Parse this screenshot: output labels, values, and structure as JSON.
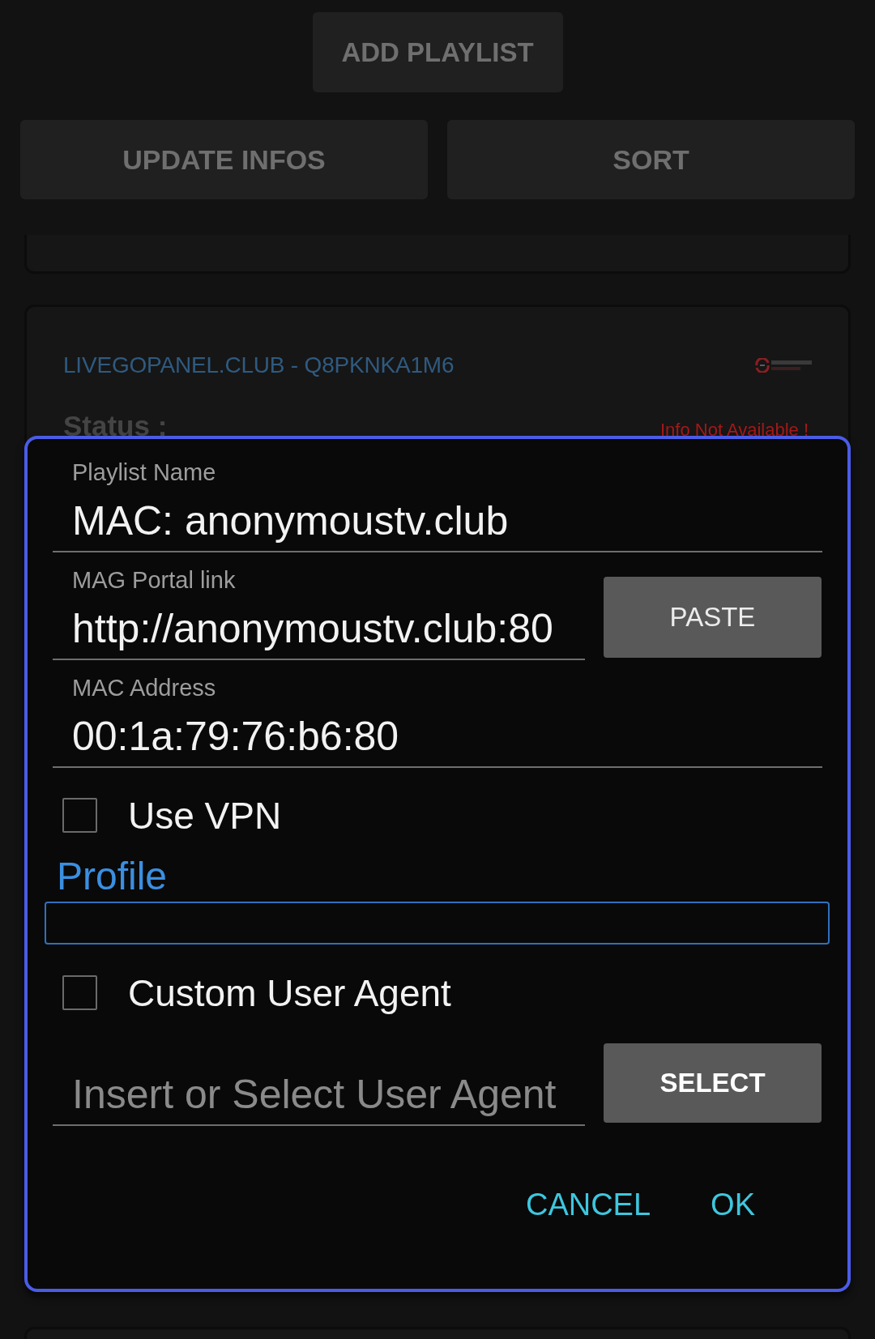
{
  "toolbar": {
    "add_button": "ADD PLAYLIST",
    "buttons": [
      "UPDATE INFOS",
      "SORT"
    ]
  },
  "playlists": [
    {
      "title": "LIVEGOPANEL.CLUB - Q8PKNKA1M6",
      "logo": {
        "kind": "swirl"
      },
      "rows": [
        {
          "label": "Status :",
          "value": "Info Not Available !",
          "kind": "error"
        }
      ]
    }
  ],
  "dialog": {
    "fields": [
      {
        "label": "Playlist Name",
        "value": "MAC: anonymoustv.club"
      },
      {
        "label": "MAG Portal link",
        "value": "http://anonymoustv.club:80",
        "button": "PASTE"
      },
      {
        "label": "MAC Address",
        "value": "00:1a:79:76:b6:80"
      }
    ],
    "use_vpn": {
      "label": "Use VPN",
      "checked": false
    },
    "profile": {
      "label": "Profile"
    },
    "custom_user_agent": {
      "label": "Custom User Agent",
      "checked": false
    },
    "user_agent": {
      "placeholder": "Insert or Select User Agent",
      "button": "SELECT"
    },
    "actions": [
      "CANCEL",
      "OK"
    ]
  }
}
